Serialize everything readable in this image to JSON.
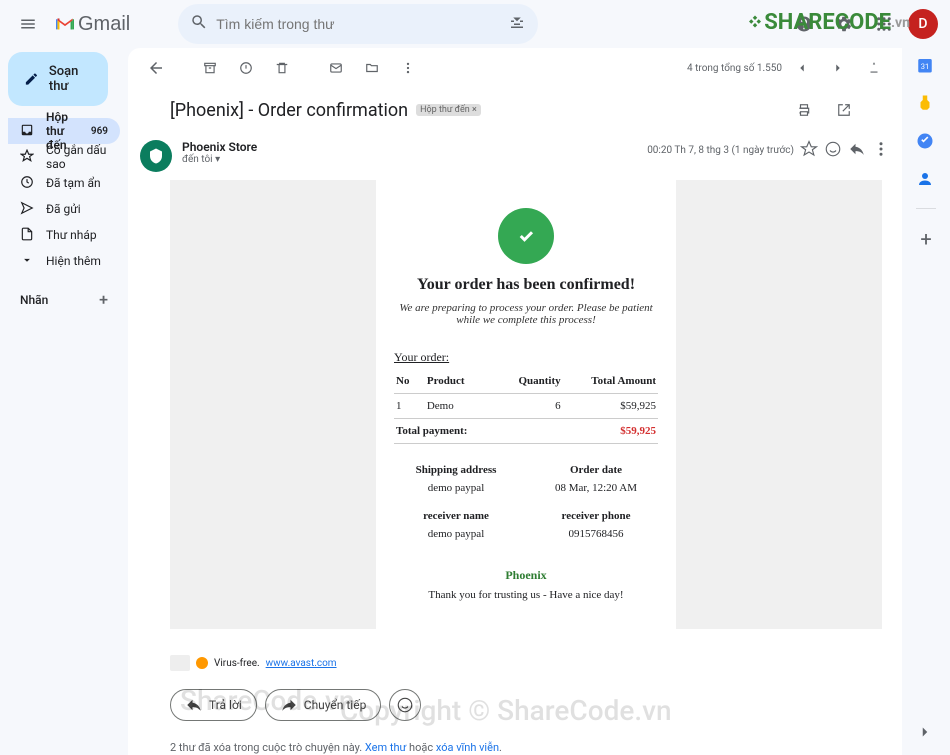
{
  "header": {
    "logo_text": "Gmail",
    "search_placeholder": "Tìm kiếm trong thư"
  },
  "sidebar": {
    "compose_label": "Soạn thư",
    "items": [
      {
        "label": "Hộp thư đến",
        "count": "969"
      },
      {
        "label": "Có gắn dấu sao"
      },
      {
        "label": "Đã tạm ẩn"
      },
      {
        "label": "Đã gửi"
      },
      {
        "label": "Thư nháp"
      },
      {
        "label": "Hiện thêm"
      }
    ],
    "labels_title": "Nhãn"
  },
  "toolbar": {
    "pager": "4 trong tổng số 1.550"
  },
  "email": {
    "subject": "[Phoenix] - Order confirmation",
    "inbox_tag": "Hộp thư đến",
    "sender_name": "Phoenix Store",
    "sender_to": "đến tôi",
    "timestamp": "00:20 Th 7, 8 thg 3 (1 ngày trước)",
    "card_title": "Your order has been confirmed!",
    "card_subtitle": "We are preparing to process your order. Please be patient while we complete this process!",
    "order_label": "Your order:",
    "headers": {
      "no": "No",
      "product": "Product",
      "qty": "Quantity",
      "total": "Total Amount"
    },
    "item": {
      "no": "1",
      "product": "Demo",
      "qty": "6",
      "total": "$59,925"
    },
    "total_label": "Total payment:",
    "total_value": "$59,925",
    "shipping_label": "Shipping address",
    "shipping_value": "demo paypal",
    "orderdate_label": "Order date",
    "orderdate_value": "08 Mar, 12:20 AM",
    "receiver_name_label": "receiver name",
    "receiver_name_value": "demo paypal",
    "receiver_phone_label": "receiver phone",
    "receiver_phone_value": "0915768456",
    "brand": "Phoenix",
    "thank_you": "Thank you for trusting us - Have a nice day!",
    "virus_free_text": "Virus-free.",
    "virus_free_link": "www.avast.com"
  },
  "actions": {
    "reply": "Trả lời",
    "forward": "Chuyển tiếp"
  },
  "info_line": {
    "text1": "2 thư đã xóa trong cuộc trò chuyện này. ",
    "link1": "Xem thư",
    "text2": " hoặc ",
    "link2": "xóa vĩnh viễn"
  },
  "watermarks": {
    "sharecode": "ShareCode.vn",
    "copyright": "Copyright © ShareCode.vn"
  },
  "avatar_letter": "D"
}
